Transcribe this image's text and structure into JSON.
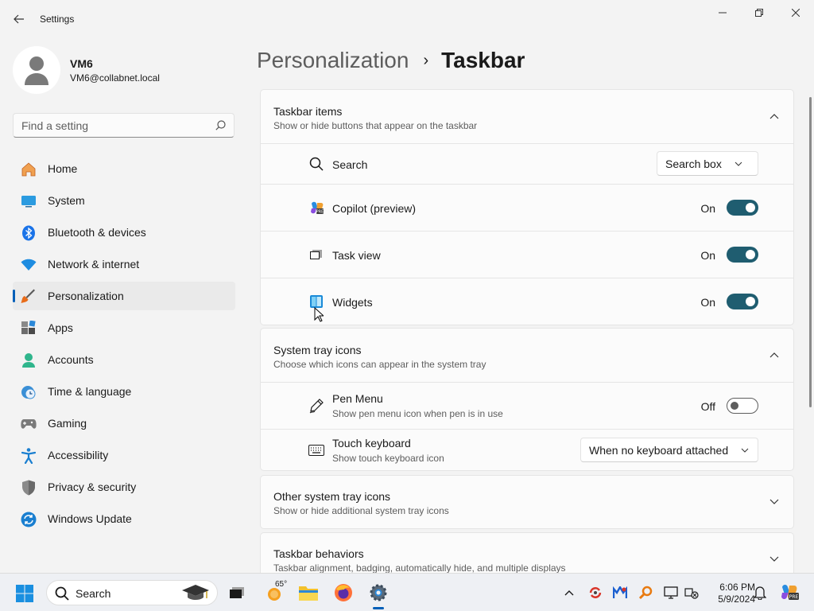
{
  "window": {
    "title": "Settings",
    "minimize_glyph": "—",
    "maximize_glyph": "❐",
    "close_glyph": "✕"
  },
  "profile": {
    "name": "VM6",
    "email": "VM6@collabnet.local"
  },
  "search": {
    "placeholder": "Find a setting"
  },
  "sidebar": {
    "items": [
      {
        "label": "Home",
        "icon": "home-icon"
      },
      {
        "label": "System",
        "icon": "system-icon"
      },
      {
        "label": "Bluetooth & devices",
        "icon": "bluetooth-icon"
      },
      {
        "label": "Network & internet",
        "icon": "wifi-icon"
      },
      {
        "label": "Personalization",
        "icon": "brush-icon",
        "active": true
      },
      {
        "label": "Apps",
        "icon": "apps-icon"
      },
      {
        "label": "Accounts",
        "icon": "accounts-icon"
      },
      {
        "label": "Time & language",
        "icon": "globe-clock-icon"
      },
      {
        "label": "Gaming",
        "icon": "gamepad-icon"
      },
      {
        "label": "Accessibility",
        "icon": "accessibility-icon"
      },
      {
        "label": "Privacy & security",
        "icon": "shield-icon"
      },
      {
        "label": "Windows Update",
        "icon": "update-icon"
      }
    ]
  },
  "breadcrumb": {
    "parent": "Personalization",
    "separator": "›",
    "current": "Taskbar"
  },
  "taskbar_items": {
    "title": "Taskbar items",
    "subtitle": "Show or hide buttons that appear on the taskbar",
    "expanded": true,
    "rows": [
      {
        "label": "Search",
        "icon": "search-icon",
        "control": "dropdown",
        "value": "Search box"
      },
      {
        "label": "Copilot (preview)",
        "icon": "copilot-icon",
        "control": "toggle",
        "state": "On"
      },
      {
        "label": "Task view",
        "icon": "task-view-icon",
        "control": "toggle",
        "state": "On"
      },
      {
        "label": "Widgets",
        "icon": "widgets-icon",
        "control": "toggle",
        "state": "On"
      }
    ]
  },
  "system_tray": {
    "title": "System tray icons",
    "subtitle": "Choose which icons can appear in the system tray",
    "expanded": true,
    "rows": [
      {
        "label": "Pen Menu",
        "sub": "Show pen menu icon when pen is in use",
        "icon": "pen-icon",
        "control": "toggle",
        "state": "Off"
      },
      {
        "label": "Touch keyboard",
        "sub": "Show touch keyboard icon",
        "icon": "keyboard-icon",
        "control": "dropdown",
        "value": "When no keyboard attached"
      }
    ]
  },
  "other_tray": {
    "title": "Other system tray icons",
    "subtitle": "Show or hide additional system tray icons",
    "expanded": false
  },
  "taskbar_behaviors": {
    "title": "Taskbar behaviors",
    "subtitle": "Taskbar alignment, badging, automatically hide, and multiple displays",
    "expanded": false
  },
  "taskbar": {
    "search_label": "Search",
    "weather_temp": "65°",
    "time": "6:06 PM",
    "date": "5/9/2024"
  },
  "colors": {
    "accent": "#005fb8",
    "toggle_on": "#1f5d70"
  }
}
